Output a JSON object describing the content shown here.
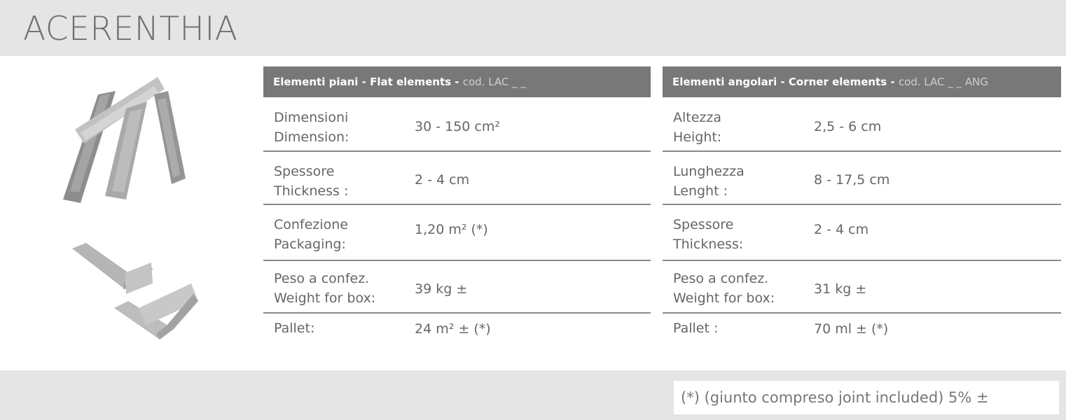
{
  "title": "ACERENTHIA",
  "flat": {
    "header_main": "Elementi piani - Flat elements - ",
    "header_code": "cod. LAC _ _",
    "rows": [
      {
        "label": "Dimensioni\nDimension:",
        "value": "30 - 150 cm²"
      },
      {
        "label": "Spessore\nThickness :",
        "value": "2 - 4 cm"
      },
      {
        "label": "Confezione\nPackaging:",
        "value": "1,20 m² (*)"
      },
      {
        "label": "Peso a confez.\nWeight for box:",
        "value": "39 kg ±"
      },
      {
        "label": "Pallet:",
        "value": "24 m² ± (*)"
      }
    ]
  },
  "corner": {
    "header_main": "Elementi angolari - Corner elements - ",
    "header_code": "cod. LAC _ _ ANG",
    "rows": [
      {
        "label": "Altezza\nHeight:",
        "value": "2,5 - 6 cm"
      },
      {
        "label": "Lunghezza\nLenght :",
        "value": "8 - 17,5 cm"
      },
      {
        "label": "Spessore\nThickness:",
        "value": "2 - 4 cm"
      },
      {
        "label": "Peso a confez.\nWeight for box:",
        "value": "31 kg ±"
      },
      {
        "label": "Pallet :",
        "value": "70 ml ±  (*)"
      }
    ]
  },
  "footnote": "(*) (giunto compreso joint included)  5% ±",
  "colors": {
    "header_bg": "#787878",
    "band_bg": "#e5e5e5",
    "rule": "#8a8a8a"
  }
}
